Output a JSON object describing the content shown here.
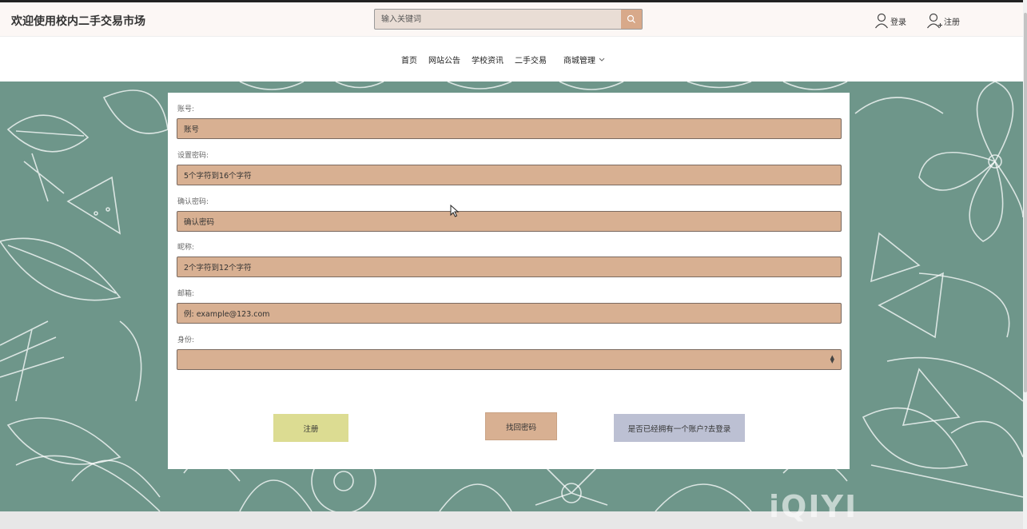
{
  "header": {
    "site_title": "欢迎使用校内二手交易市场",
    "search_placeholder": "输入关键词",
    "login_label": "登录",
    "register_label": "注册"
  },
  "nav": {
    "items": [
      "首页",
      "网站公告",
      "学校资讯",
      "二手交易"
    ],
    "dropdown_label": "商城管理"
  },
  "form": {
    "fields": [
      {
        "label": "账号:",
        "value": "账号"
      },
      {
        "label": "设置密码:",
        "value": "5个字符到16个字符"
      },
      {
        "label": "确认密码:",
        "value": "确认密码"
      },
      {
        "label": "昵称:",
        "value": "2个字符到12个字符"
      },
      {
        "label": "邮箱:",
        "value": "例: example@123.com"
      }
    ],
    "identity": {
      "label": "身份:",
      "selected": ""
    },
    "buttons": {
      "register": "注册",
      "forgot": "找回密码",
      "go_login": "是否已经拥有一个账户?去登录"
    }
  },
  "watermark": "iQIYI",
  "colors": {
    "background_teal": "#6e968a",
    "input_fill": "#d8b092",
    "register_button": "#dcdc92",
    "login_button": "#bcc0d3"
  }
}
